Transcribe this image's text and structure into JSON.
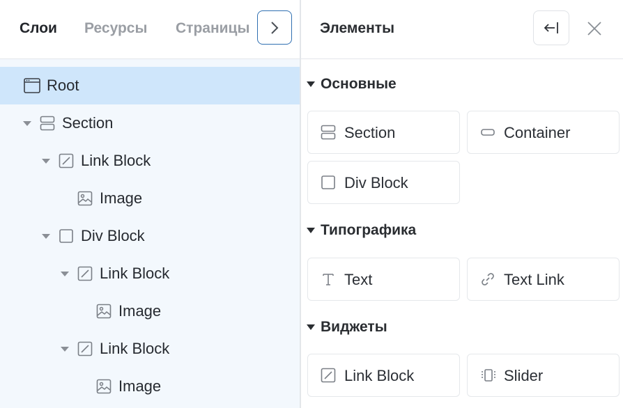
{
  "tabs": [
    {
      "label": "Слои",
      "active": true
    },
    {
      "label": "Ресурсы",
      "active": false
    },
    {
      "label": "Страницы",
      "active": false
    }
  ],
  "tree": [
    {
      "label": "Root",
      "icon": "window-icon",
      "selected": true
    },
    {
      "label": "Section",
      "icon": "section-icon",
      "expanded": true
    },
    {
      "label": "Link Block",
      "icon": "link-block-icon",
      "expanded": true
    },
    {
      "label": "Image",
      "icon": "image-icon"
    },
    {
      "label": "Div Block",
      "icon": "div-block-icon",
      "expanded": true
    },
    {
      "label": "Link Block",
      "icon": "link-block-icon",
      "expanded": true
    },
    {
      "label": "Image",
      "icon": "image-icon"
    },
    {
      "label": "Link Block",
      "icon": "link-block-icon",
      "expanded": true
    },
    {
      "label": "Image",
      "icon": "image-icon"
    }
  ],
  "panel": {
    "title": "Элементы",
    "sections": [
      {
        "title": "Основные",
        "items": [
          {
            "label": "Section",
            "icon": "section-icon"
          },
          {
            "label": "Container",
            "icon": "container-icon"
          },
          {
            "label": "Div Block",
            "icon": "div-block-icon"
          }
        ]
      },
      {
        "title": "Типографика",
        "items": [
          {
            "label": "Text",
            "icon": "text-icon"
          },
          {
            "label": "Text Link",
            "icon": "link-icon"
          }
        ]
      },
      {
        "title": "Виджеты",
        "items": [
          {
            "label": "Link Block",
            "icon": "link-block-icon"
          },
          {
            "label": "Slider",
            "icon": "slider-icon"
          }
        ]
      }
    ]
  },
  "colors": {
    "accent": "#2f6fb1",
    "selected_row": "#cfe6fb",
    "tree_bg": "#f3f8fd"
  }
}
